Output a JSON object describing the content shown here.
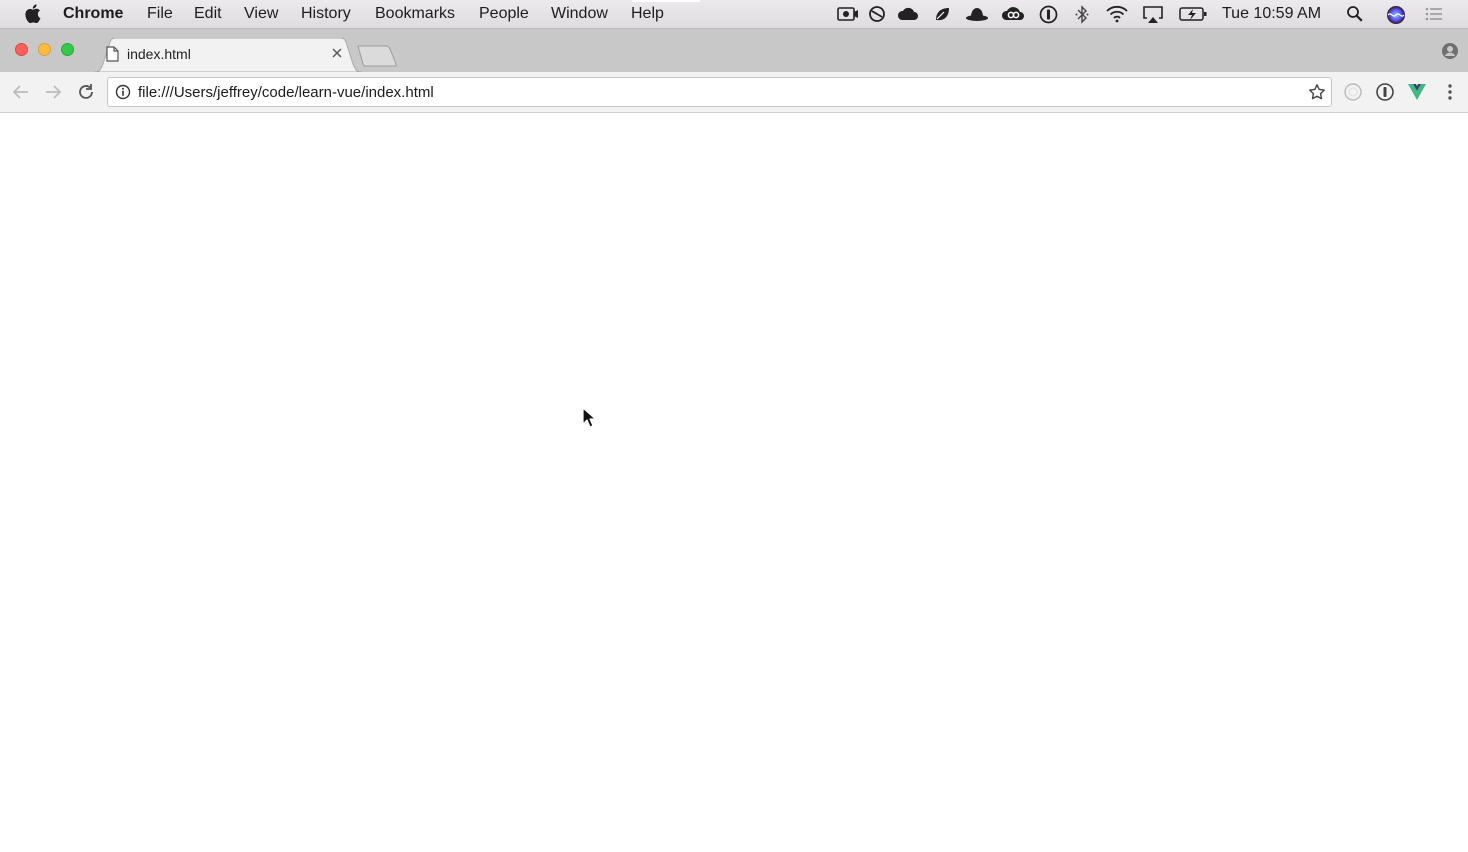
{
  "menubar": {
    "app_name": "Chrome",
    "items": [
      "File",
      "Edit",
      "View",
      "History",
      "Bookmarks",
      "People",
      "Window",
      "Help"
    ],
    "clock": "Tue 10:59 AM",
    "status_icons": [
      "screen-record-icon",
      "blocked-icon",
      "cloud-icon",
      "leaf-icon",
      "hat-icon",
      "creative-cloud-icon",
      "password-icon",
      "bluetooth-icon",
      "wifi-icon",
      "airplay-icon",
      "battery-icon",
      "spotlight-icon",
      "siri-icon",
      "notification-center-icon"
    ]
  },
  "tabs": [
    {
      "title": "index.html",
      "icon": "document-icon"
    }
  ],
  "toolbar": {
    "url": "file:///Users/jeffrey/code/learn-vue/index.html"
  },
  "colors": {
    "close": "#fc605c",
    "minimize": "#fdbc40",
    "maximize": "#34c84a",
    "vue_green": "#41b883"
  }
}
